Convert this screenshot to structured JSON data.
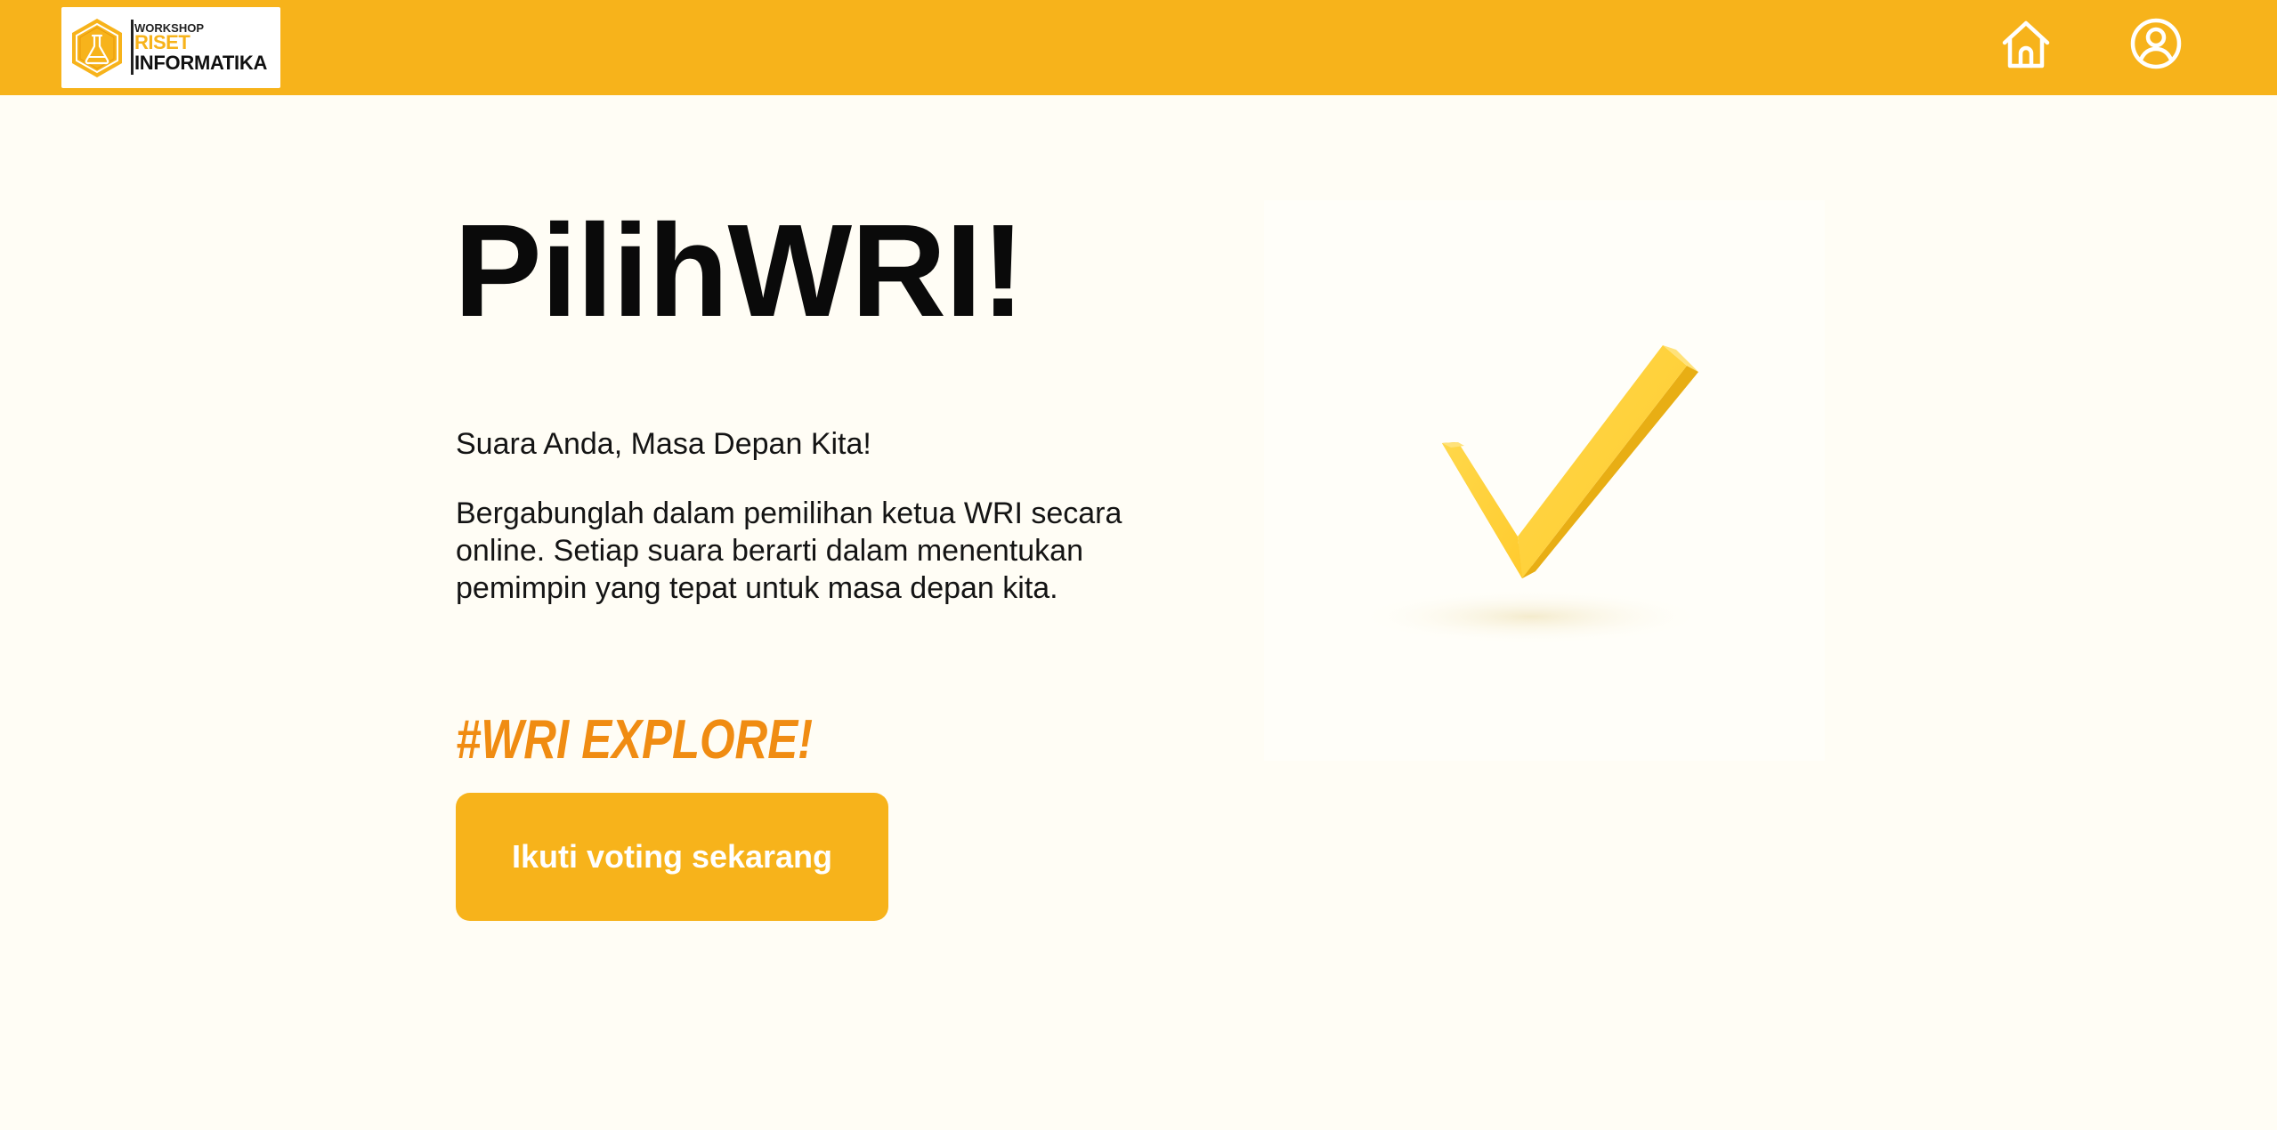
{
  "header": {
    "logo": {
      "line1": "WORKSHOP",
      "line2": "RISET",
      "line3": "INFORMATIKA"
    },
    "icons": {
      "home": "home-icon",
      "profile": "user-circle-icon"
    }
  },
  "hero": {
    "title": "PilihWRI!",
    "tagline": "Suara Anda, Masa Depan Kita!",
    "description": "Bergabunglah dalam pemilihan ketua WRI secara online. Setiap suara berarti dalam menentukan pemimpin yang tepat untuk masa depan kita.",
    "hashtag": "#WRI EXPLORE!",
    "cta_label": "Ikuti voting sekarang",
    "illustration": "checkmark-icon"
  },
  "colors": {
    "navbar": "#F7B31B",
    "background": "#FFFDF5",
    "button": "#F7B31B",
    "hashtag": "#F08C12",
    "checkmark": "#FFD23F"
  }
}
